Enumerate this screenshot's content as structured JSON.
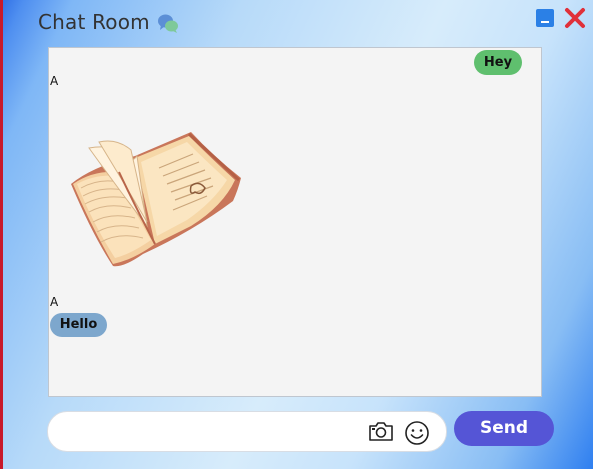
{
  "window": {
    "title": "Chat Room",
    "title_icon": "chat-bubbles-icon",
    "minimize_icon": "minimize-icon",
    "close_icon": "close-icon"
  },
  "messages": [
    {
      "side": "right",
      "text": "Hey",
      "color": "#5fbf6e"
    },
    {
      "side": "left",
      "sender": "A",
      "type": "image",
      "image": "open-book-image"
    },
    {
      "side": "left",
      "sender": "A",
      "text": "Hello",
      "color": "#7da7cd"
    }
  ],
  "composer": {
    "input_value": "",
    "input_placeholder": "",
    "camera_icon": "camera-icon",
    "emoji_icon": "smiley-icon",
    "send_label": "Send"
  },
  "colors": {
    "send": "#5555d6",
    "minimize": "#2b80e6",
    "close": "#e0303a"
  }
}
